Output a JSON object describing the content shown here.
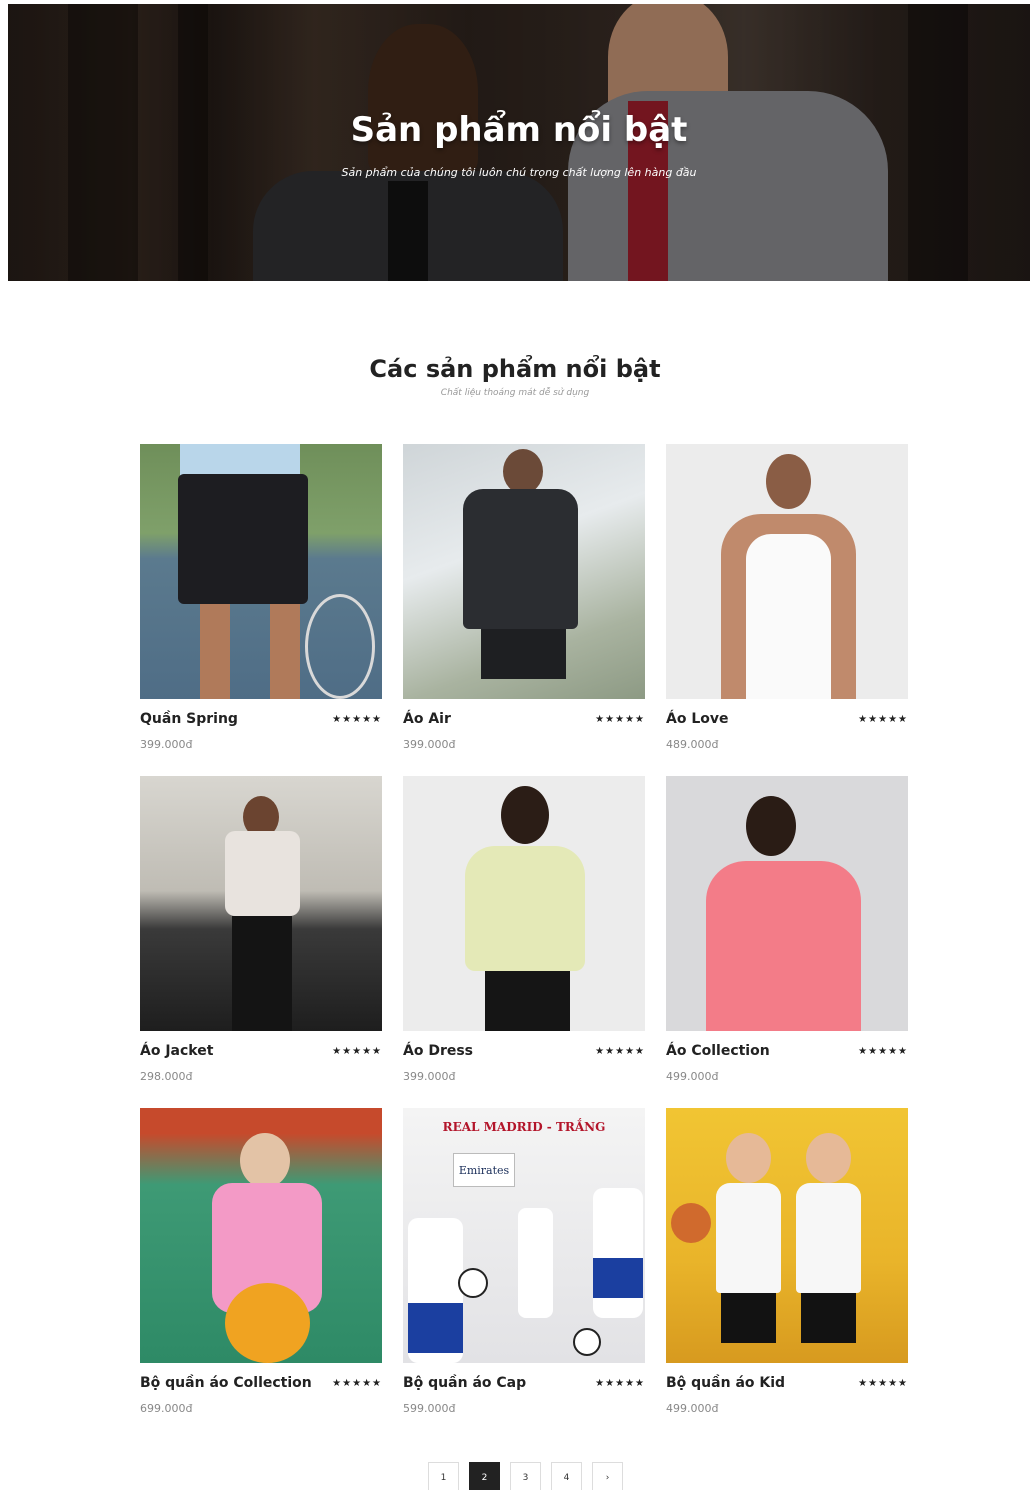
{
  "hero": {
    "title": "Sản phẩm nổi bật",
    "subtitle": "Sản phẩm của chúng tôi luôn chú trọng chất lượng lên hàng đầu"
  },
  "section": {
    "title": "Các sản phẩm nổi bật",
    "subtitle": "Chất liệu thoáng mát dễ sử dụng"
  },
  "products": [
    {
      "name": "Quần Spring",
      "price": "399.000đ",
      "rating": "★★★★★"
    },
    {
      "name": "Áo Air",
      "price": "399.000đ",
      "rating": "★★★★★"
    },
    {
      "name": "Áo Love",
      "price": "489.000đ",
      "rating": "★★★★★"
    },
    {
      "name": "Áo Jacket",
      "price": "298.000đ",
      "rating": "★★★★★"
    },
    {
      "name": "Áo Dress",
      "price": "399.000đ",
      "rating": "★★★★★"
    },
    {
      "name": "Áo Collection",
      "price": "499.000đ",
      "rating": "★★★★★"
    },
    {
      "name": "Bộ quần áo Collection",
      "price": "699.000đ",
      "rating": "★★★★★"
    },
    {
      "name": "Bộ quần áo Cap",
      "price": "599.000đ",
      "rating": "★★★★★"
    },
    {
      "name": "Bộ quần áo Kid",
      "price": "499.000đ",
      "rating": "★★★★★"
    }
  ],
  "thumb_text": {
    "real_madrid": "REAL MADRID - TRẮNG",
    "emirates": "Emirates"
  },
  "pagination": {
    "pages": [
      "1",
      "2",
      "3",
      "4"
    ],
    "current": "2",
    "next": "›"
  }
}
